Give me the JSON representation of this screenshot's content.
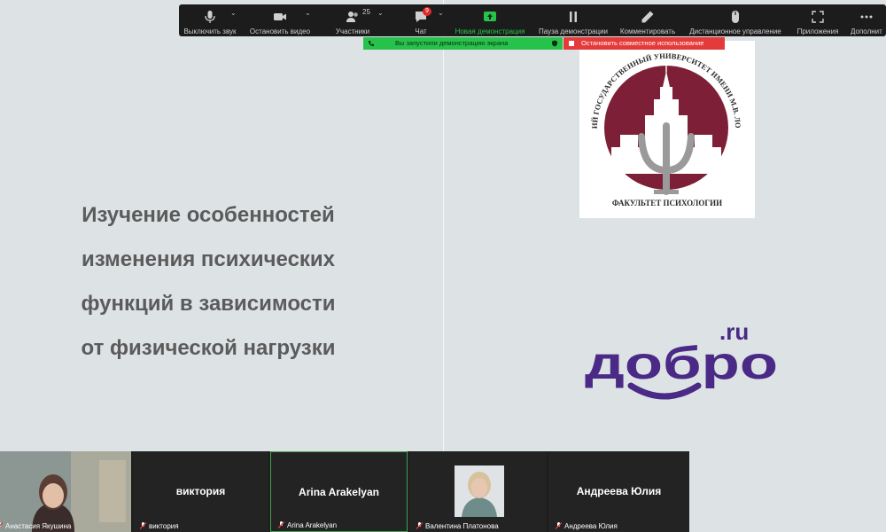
{
  "toolbar": {
    "buttons": [
      {
        "label": "Выключить звук",
        "icon": "microphone-icon"
      },
      {
        "label": "Остановить видео",
        "icon": "video-camera-icon"
      },
      {
        "label": "Участники",
        "icon": "participants-icon",
        "count": "25"
      },
      {
        "label": "Чат",
        "icon": "chat-icon",
        "badge": "9"
      },
      {
        "label": "Новая демонстрация",
        "icon": "share-screen-icon",
        "color": "#26c34a"
      },
      {
        "label": "Пауза демонстрации",
        "icon": "pause-icon"
      },
      {
        "label": "Комментировать",
        "icon": "pencil-icon"
      },
      {
        "label": "Дистанционное управление",
        "icon": "mouse-icon"
      },
      {
        "label": "Приложения",
        "icon": "apps-icon"
      },
      {
        "label": "Дополнит",
        "icon": "more-icon"
      }
    ]
  },
  "share_status": {
    "message": "Вы запустили демонстрацию экрана",
    "stop_label": "Остановить совместное использование",
    "share_color": "#27c24c",
    "stop_color": "#e53a3a"
  },
  "slide": {
    "title_lines": [
      "Изучение особенностей",
      "изменения психических",
      "функций в зависимости",
      "от физической нагрузки"
    ],
    "msu_logo_text": "МОСКОВСКИЙ ГОСУДАРСТВЕННЫЙ УНИВЕРСИТЕТ ИМЕНИ М.В. ЛОМОНОСОВА",
    "msu_logo_subtitle": "ФАКУЛЬТЕТ ПСИХОЛОГИИ",
    "dobro_logo_text": "добро",
    "dobro_logo_tld": ".ru",
    "msu_color": "#7d1f36",
    "dobro_color": "#4a2a86"
  },
  "participants": [
    {
      "display": "",
      "label": "Анастасия Якушина",
      "has_video": true
    },
    {
      "display": "виктория",
      "label": "виктория",
      "has_video": false
    },
    {
      "display": "Arina Arakelyan",
      "label": "Arina Arakelyan",
      "has_video": false
    },
    {
      "display": "",
      "label": "Валентина Платонова",
      "has_video": true
    },
    {
      "display": "Андреева Юлия",
      "label": "Андреева Юлия",
      "has_video": false
    }
  ]
}
